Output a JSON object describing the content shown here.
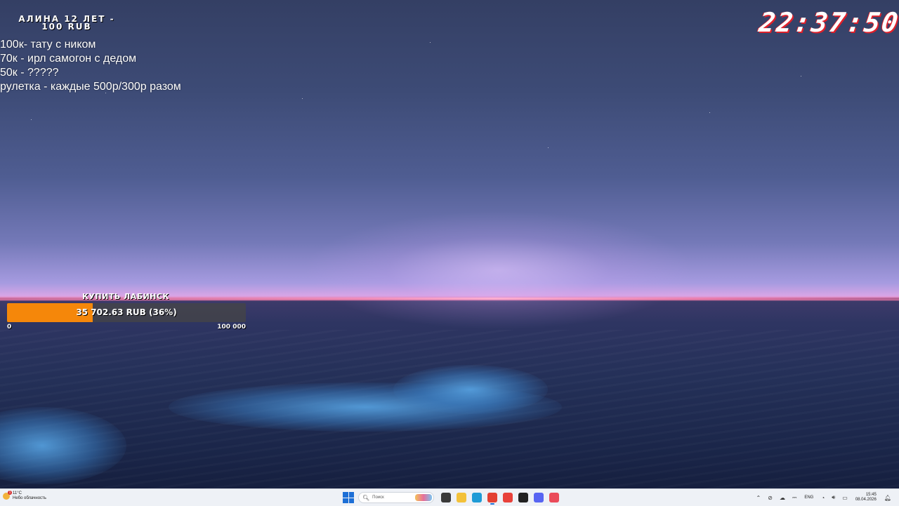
{
  "overlay": {
    "title_line1": "АЛИНА 12 ЛЕТ -",
    "title_line2": "100 RUB",
    "goals": [
      "100к- тату с ником",
      "70к - ирл самогон с дедом",
      "50к - ?????",
      "рулетка - каждые 500р/300р разом"
    ]
  },
  "clock": {
    "time": "22:37:50"
  },
  "donation_goal": {
    "label": "КУПИТЬ ЛАБИНСК",
    "progress_text": "35 702.63 RUB (36%)",
    "progress_fraction": 0.36,
    "min_label": "0",
    "max_label": "100 000",
    "fill_color": "#f5870a"
  },
  "taskbar": {
    "weather_temp": "11°C",
    "weather_desc": "Небо облачность",
    "weather_alert": "1",
    "search_placeholder": "Поиск",
    "apps": [
      {
        "name": "task-view",
        "color": "#3a3a3a"
      },
      {
        "name": "file-explorer",
        "color": "#f3c13a"
      },
      {
        "name": "edge",
        "color": "#1f9bd6"
      },
      {
        "name": "chrome",
        "color": "#e34133",
        "active": true
      },
      {
        "name": "yandex-browser",
        "color": "#e8413a"
      },
      {
        "name": "steam",
        "color": "#222222"
      },
      {
        "name": "discord",
        "color": "#5865f2"
      },
      {
        "name": "telegram",
        "color": "#ea4b5a"
      }
    ],
    "lang": "ENG",
    "time": "15:45",
    "date": "08.04.2026"
  }
}
